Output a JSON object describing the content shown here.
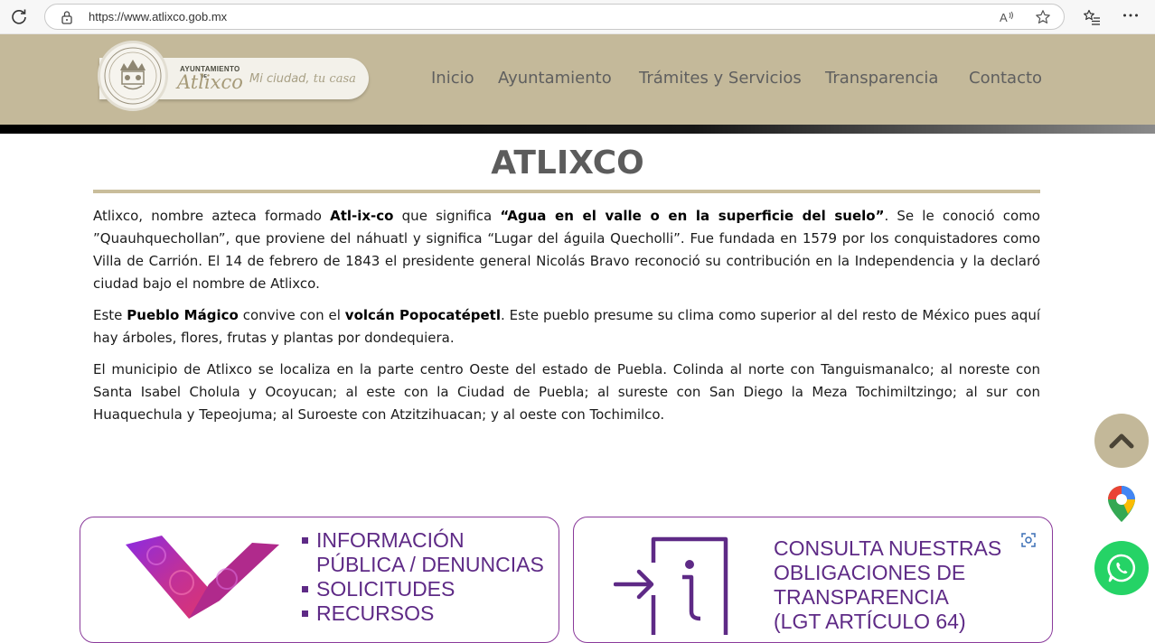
{
  "browser": {
    "url": "https://www.atlixco.gob.mx"
  },
  "header": {
    "logo": {
      "small_text": "AYUNTAMIENTO",
      "de_text": "DE",
      "name": "Atlixco",
      "slogan_plain": "Mi ciudad, ",
      "slogan_script": "tu casa"
    },
    "nav": [
      "Inicio",
      "Ayuntamiento",
      "Trámites y Servicios",
      "Transparencia",
      "Contacto"
    ]
  },
  "content": {
    "title": "ATLIXCO",
    "p1": {
      "t1": "Atlixco, nombre azteca formado ",
      "b1": "Atl-ix-co",
      "t2": " que significa ",
      "b2": "“Agua en el valle o en la superficie del suelo”",
      "t3": ". Se le conoció como ”Quauhquechollan”, que proviene del náhuatl y significa “Lugar del águila Quecholli”. Fue fundada en 1579 por los conquistadores como Villa de Carrión. El 14 de febrero de 1843 el presidente general Nicolás Bravo reconoció su contribución en la Independencia y la declaró ciudad bajo el nombre de Atlixco."
    },
    "p2": {
      "t1": "Este ",
      "b1": "Pueblo Mágico",
      "t2": " convive con el ",
      "b2": "volcán Popocatépetl",
      "t3": ". Este pueblo presume su clima como superior al del resto de México pues aquí hay árboles, flores, frutas y plantas por dondequiera."
    },
    "p3": "El municipio de Atlixco se localiza en la parte centro Oeste del estado de Puebla. Colinda al norte con Tanguismanalco; al noreste con Santa Isabel Cholula y Ocoyucan; al este con la Ciudad de Puebla; al sureste con San Diego la Meza Tochimiltzingo; al sur con Huaquechula y Tepeojuma; al Suroeste con Atzitzihuacan; y al oeste con Tochimilco."
  },
  "cards": {
    "left": {
      "line1": "INFORMACIÓN",
      "line2": "PÚBLICA / DENUNCIAS",
      "line3": "SOLICITUDES",
      "line4": "RECURSOS"
    },
    "right": {
      "line1": "CONSULTA NUESTRAS",
      "line2": "OBLIGACIONES DE",
      "line3": "TRANSPARENCIA",
      "line4": "(LGT ARTÍCULO 64)"
    }
  },
  "colors": {
    "header_bg": "#c4b99a",
    "title_rule": "#c9bd9b",
    "card_purple": "#5e2a86",
    "whatsapp": "#25d366"
  }
}
